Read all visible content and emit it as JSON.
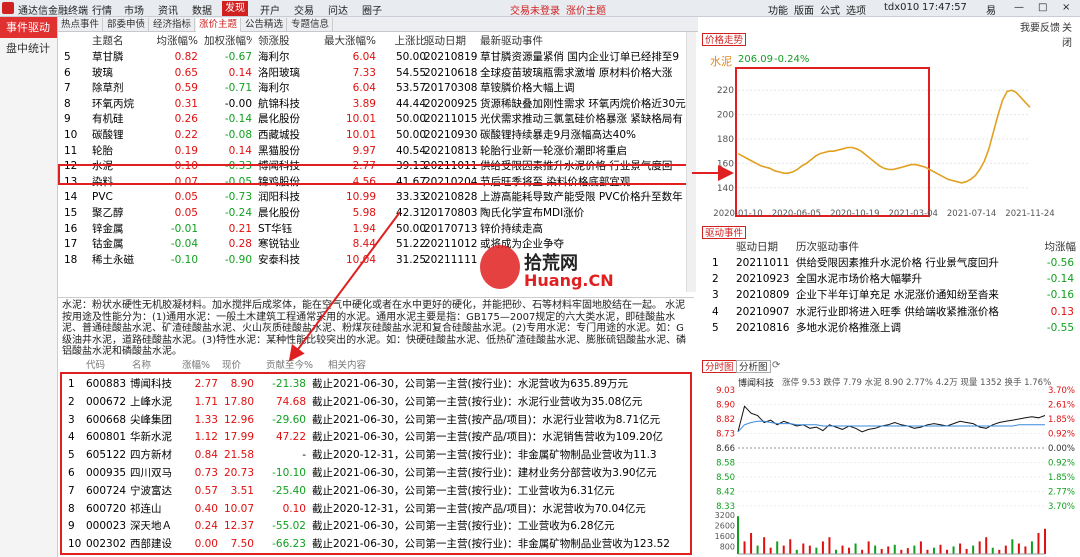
{
  "app": {
    "title": "通达信金融终端",
    "menus": [
      "行情",
      "市场",
      "资讯",
      "数据",
      "发现",
      "开户",
      "交易",
      "问达",
      "圈子"
    ],
    "active_menu": "发现",
    "alerts": [
      "交易未登录",
      "涨价主题"
    ],
    "right_menus": [
      "功能",
      "版面",
      "公式",
      "选项"
    ],
    "user": "tdx010",
    "time": "17:47:57",
    "window_buttons": [
      "易",
      "—",
      "□",
      "×"
    ],
    "right_links": [
      "我要反馈",
      "关闭"
    ]
  },
  "sidebar": {
    "items": [
      "事件驱动",
      "盘中统计"
    ],
    "active": "事件驱动"
  },
  "tabs": [
    "热点事件",
    "部委申债",
    "经济指标",
    "涨价主题",
    "公告精选",
    "专题信息"
  ],
  "active_tab": "涨价主题",
  "topic_table": {
    "headers": [
      "主题名",
      "均涨幅%",
      "加权涨幅%",
      "领涨股",
      "最大涨幅%",
      "上涨比",
      "驱动日期",
      "最新驱动事件"
    ],
    "rows": [
      {
        "no": "5",
        "name": "草甘膦",
        "avg": "0.82",
        "wavg": "-0.67",
        "leader": "海利尔",
        "max": "6.04",
        "ratio": "50.00",
        "date": "20210819",
        "event": "草甘膦资源量紧俏 国内企业订单已经排至9"
      },
      {
        "no": "6",
        "name": "玻璃",
        "avg": "0.65",
        "wavg": "0.14",
        "leader": "洛阳玻璃",
        "max": "7.33",
        "ratio": "54.55",
        "date": "20210618",
        "event": "全球疫苗玻璃瓶需求激增 原材料价格大涨"
      },
      {
        "no": "7",
        "name": "除草剂",
        "avg": "0.59",
        "wavg": "-0.71",
        "leader": "海利尔",
        "max": "6.04",
        "ratio": "53.57",
        "date": "20170308",
        "event": "草铵膦价格大幅上调"
      },
      {
        "no": "8",
        "name": "环氧丙烷",
        "avg": "0.31",
        "wavg": "-0.00",
        "leader": "航锦科技",
        "max": "3.89",
        "ratio": "44.44",
        "date": "20200925",
        "event": "货源稀缺叠加刚性需求 环氧丙烷价格近30元"
      },
      {
        "no": "9",
        "name": "有机硅",
        "avg": "0.26",
        "wavg": "-0.14",
        "leader": "晨化股份",
        "max": "10.01",
        "ratio": "50.00",
        "date": "20211015",
        "event": "光伏需求推动三氯氢硅价格暴涨 紧缺格局有"
      },
      {
        "no": "10",
        "name": "碳酸锂",
        "avg": "0.22",
        "wavg": "-0.08",
        "leader": "西藏城投",
        "max": "10.01",
        "ratio": "50.00",
        "date": "20210930",
        "event": "碳酸锂持续暴走9月涨幅高达40%"
      },
      {
        "no": "11",
        "name": "轮胎",
        "avg": "0.19",
        "wavg": "0.14",
        "leader": "黑猫股份",
        "max": "9.97",
        "ratio": "40.54",
        "date": "20210813",
        "event": "轮胎行业新一轮涨价潮即将重启"
      },
      {
        "no": "12",
        "name": "水泥",
        "avg": "0.10",
        "wavg": "-0.33",
        "leader": "博闻科技",
        "max": "2.77",
        "ratio": "39.13",
        "date": "20211011",
        "event": "供给受限因素推升水泥价格 行业景气度回"
      },
      {
        "no": "13",
        "name": "染料",
        "avg": "0.07",
        "wavg": "-0.05",
        "leader": "锦鸡股份",
        "max": "4.56",
        "ratio": "41.67",
        "date": "20210204",
        "event": "节后旺季将至 染料价格底部宜观"
      },
      {
        "no": "14",
        "name": "PVC",
        "avg": "0.05",
        "wavg": "-0.73",
        "leader": "润阳科技",
        "max": "10.99",
        "ratio": "33.33",
        "date": "20210828",
        "event": "上游高能耗导致产能受限 PVC价格升至数年"
      },
      {
        "no": "15",
        "name": "聚乙醇",
        "avg": "0.05",
        "wavg": "-0.24",
        "leader": "晨化股份",
        "max": "5.98",
        "ratio": "42.31",
        "date": "20170803",
        "event": "陶氏化学宣布MDI涨价"
      },
      {
        "no": "16",
        "name": "锌金属",
        "avg": "-0.01",
        "wavg": "0.21",
        "leader": "ST华钰",
        "max": "1.94",
        "ratio": "50.00",
        "date": "20170713",
        "event": "锌价持续走高"
      },
      {
        "no": "17",
        "name": "钴金属",
        "avg": "-0.04",
        "wavg": "0.28",
        "leader": "寒锐钴业",
        "max": "8.44",
        "ratio": "51.22",
        "date": "20211012",
        "event": "或将成为企业争夺"
      },
      {
        "no": "18",
        "name": "稀土永磁",
        "avg": "-0.10",
        "wavg": "-0.90",
        "leader": "安泰科技",
        "max": "10.04",
        "ratio": "31.25",
        "date": "20211111",
        "event": ""
      }
    ]
  },
  "description": "水泥：粉状水硬性无机胶凝材料。加水搅拌后成浆体，能在空气中硬化或者在水中更好的硬化，并能把砂、石等材料牢固地胶结在一起。 水泥按用途及性能分为：(1)通用水泥：一般土木建筑工程通常采用的水泥。通用水泥主要是指：GB175—2007规定的六大类水泥，即硅酸盐水泥、普通硅酸盐水泥、矿渣硅酸盐水泥、火山灰质硅酸盐水泥、粉煤灰硅酸盐水泥和复合硅酸盐水泥。(2)专用水泥：专门用途的水泥。如：G级油井水泥，道路硅酸盐水泥。(3)特性水泥：某种性能比较突出的水泥。如：快硬硅酸盐水泥、低热矿渣硅酸盐水泥、膨胀硫铝酸盐水泥、磷铝酸盐水泥和磷酸盐水泥。",
  "stock_table": {
    "headers": [
      "代码",
      "名称",
      "涨幅%",
      "现价",
      "贡献至今%",
      "相关内容"
    ],
    "rows": [
      {
        "no": "1",
        "code": "600883",
        "name": "博闻科技",
        "chg": "2.77",
        "price": "8.90",
        "contrib": "-21.38",
        "content": "截止2021-06-30，公司第一主营(按行业)：水泥营收为635.89万元"
      },
      {
        "no": "2",
        "code": "000672",
        "name": "上峰水泥",
        "chg": "1.71",
        "price": "17.80",
        "contrib": "74.68",
        "content": "截止2021-06-30，公司第一主营(按行业)：水泥行业营收为35.08亿元"
      },
      {
        "no": "3",
        "code": "600668",
        "name": "尖峰集团",
        "chg": "1.33",
        "price": "12.96",
        "contrib": "-29.60",
        "content": "截止2021-06-30，公司第一主营(按产品/项目)：水泥行业营收为8.71亿元"
      },
      {
        "no": "4",
        "code": "600801",
        "name": "华新水泥",
        "chg": "1.12",
        "price": "17.99",
        "contrib": "47.22",
        "content": "截止2021-06-30，公司第一主营(按产品/项目)：水泥销售营收为109.20亿"
      },
      {
        "no": "5",
        "code": "605122",
        "name": "四方新材",
        "chg": "0.84",
        "price": "21.58",
        "contrib": "-",
        "content": "截止2020-12-31，公司第一主营(按行业)：非金属矿物制品业营收为11.3"
      },
      {
        "no": "6",
        "code": "000935",
        "name": "四川双马",
        "chg": "0.73",
        "price": "20.73",
        "contrib": "-10.10",
        "content": "截止2021-06-30，公司第一主营(按行业)：建材业务分部营收为3.90亿元"
      },
      {
        "no": "7",
        "code": "600724",
        "name": "宁波富达",
        "chg": "0.57",
        "price": "3.51",
        "contrib": "-25.40",
        "content": "截止2021-06-30，公司第一主营(按行业)：工业营收为6.31亿元"
      },
      {
        "no": "8",
        "code": "600720",
        "name": "祁连山",
        "chg": "0.40",
        "price": "10.07",
        "contrib": "0.10",
        "content": "截止2020-12-31，公司第一主营(按产品/项目)：水泥营收为70.04亿元"
      },
      {
        "no": "9",
        "code": "000023",
        "name": "深天地Ａ",
        "chg": "0.24",
        "price": "12.37",
        "contrib": "-55.02",
        "content": "截止2021-06-30，公司第一主营(按行业)：工业营收为6.28亿元"
      },
      {
        "no": "10",
        "code": "002302",
        "name": "西部建设",
        "chg": "0.00",
        "price": "7.50",
        "contrib": "-66.23",
        "content": "截止2021-06-30，公司第一主营(按行业)：非金属矿物制品业营收为123.52"
      }
    ]
  },
  "price_panel": {
    "tab": "价格走势",
    "commodity": "水泥",
    "price": "206.09",
    "change": "-0.24%",
    "chart_data": {
      "type": "line",
      "x_ticks": [
        "2020-01-10",
        "2020-06-05",
        "2020-10-19",
        "2021-03-04",
        "2021-07-14",
        "2021-11-24"
      ],
      "y_ticks": [
        "220",
        "200",
        "180",
        "160",
        "140"
      ],
      "ylim": [
        130,
        230
      ],
      "values": [
        168,
        166,
        164,
        162,
        160,
        158,
        157,
        156,
        154,
        153,
        152,
        152,
        153,
        155,
        158,
        160,
        163,
        166,
        168,
        169,
        170,
        170,
        171,
        172,
        173,
        173,
        172,
        170,
        167,
        164,
        161,
        158,
        156,
        155,
        155,
        156,
        157,
        158,
        159,
        159,
        158,
        157,
        155,
        153,
        151,
        149,
        147,
        146,
        145,
        144,
        145,
        147,
        150,
        155,
        162,
        172,
        186,
        200,
        212,
        219,
        220,
        218,
        214,
        210,
        206
      ]
    }
  },
  "driver_panel": {
    "tab": "驱动事件",
    "headers": [
      "驱动日期",
      "历次驱动事件",
      "均涨幅"
    ],
    "rows": [
      {
        "no": "1",
        "date": "20211011",
        "event": "供给受限因素推升水泥价格 行业景气度回升",
        "avg": "-0.56"
      },
      {
        "no": "2",
        "date": "20210923",
        "event": "全国水泥市场价格大幅攀升",
        "avg": "-0.14"
      },
      {
        "no": "3",
        "date": "20210809",
        "event": "企业下半年订单充足 水泥涨价通知纷至沓来",
        "avg": "-0.16"
      },
      {
        "no": "4",
        "date": "20210907",
        "event": "水泥行业即将进入旺季 供给端收紧推涨价格",
        "avg": "0.13"
      },
      {
        "no": "5",
        "date": "20210816",
        "event": "多地水泥价格推涨上调",
        "avg": "-0.55"
      }
    ]
  },
  "analysis_panel": {
    "tabs": [
      "分时图",
      "分析图"
    ],
    "stock_name": "博闻科技",
    "info": "涨停 9.53  跌停 7.79  水泥 8.90  2.77%  4.2万  现量 1352  换手 1.76%",
    "left_ticks": [
      "9.03",
      "8.90",
      "8.82",
      "8.73",
      "8.66",
      "8.58",
      "8.50",
      "8.42",
      "8.33"
    ],
    "right_ticks": [
      "3.70%",
      "2.61%",
      "1.85%",
      "0.92%",
      "0.00%",
      "0.92%",
      "1.85%",
      "2.77%",
      "3.70%"
    ],
    "vol_ticks": [
      "3200",
      "2600",
      "1600",
      "800"
    ],
    "time_ticks": [
      "9:30",
      "10:30",
      "13:00",
      "14:00",
      "15:00"
    ]
  },
  "watermark": {
    "text1": "拾荒网",
    "text2": "Huang.CN"
  }
}
